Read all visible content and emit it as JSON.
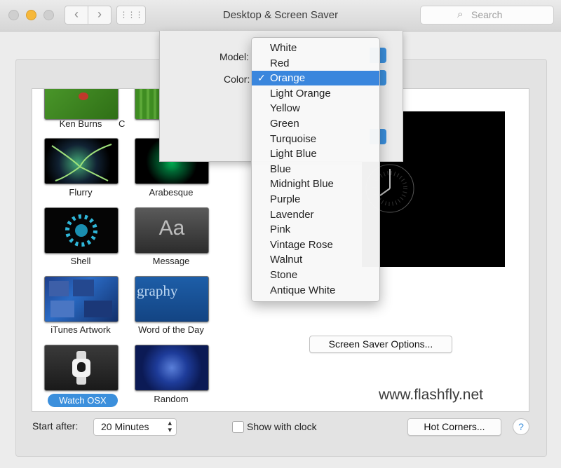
{
  "window": {
    "title": "Desktop & Screen Saver"
  },
  "search": {
    "placeholder": "Search"
  },
  "savers": [
    {
      "label": "Ken Burns"
    },
    {
      "label": "C"
    },
    {
      "label": "Flurry"
    },
    {
      "label": "Arabesque"
    },
    {
      "label": "Shell"
    },
    {
      "label": "Message",
      "thumb_text": "Aa"
    },
    {
      "label": "iTunes Artwork"
    },
    {
      "label": "Word of the Day",
      "thumb_text": "graphy"
    },
    {
      "label": "Watch OSX",
      "selected": true
    },
    {
      "label": "Random"
    }
  ],
  "sheet": {
    "model_label": "Model:",
    "color_label": "Color:"
  },
  "color_menu": {
    "items": [
      "White",
      "Red",
      "Orange",
      "Light Orange",
      "Yellow",
      "Green",
      "Turquoise",
      "Light Blue",
      "Blue",
      "Midnight Blue",
      "Purple",
      "Lavender",
      "Pink",
      "Vintage Rose",
      "Walnut",
      "Stone",
      "Antique White"
    ],
    "selected": "Orange",
    "checkmark": "✓"
  },
  "preview": {
    "options_button": "Screen Saver Options..."
  },
  "watermark": "www.flashfly.net",
  "bottom": {
    "start_after_label": "Start after:",
    "start_after_value": "20 Minutes",
    "show_clock_label": "Show with clock",
    "hot_corners_button": "Hot Corners...",
    "help": "?"
  },
  "colors": {
    "accent": "#3b8fdc",
    "menu_highlight": "#3a86dd"
  }
}
